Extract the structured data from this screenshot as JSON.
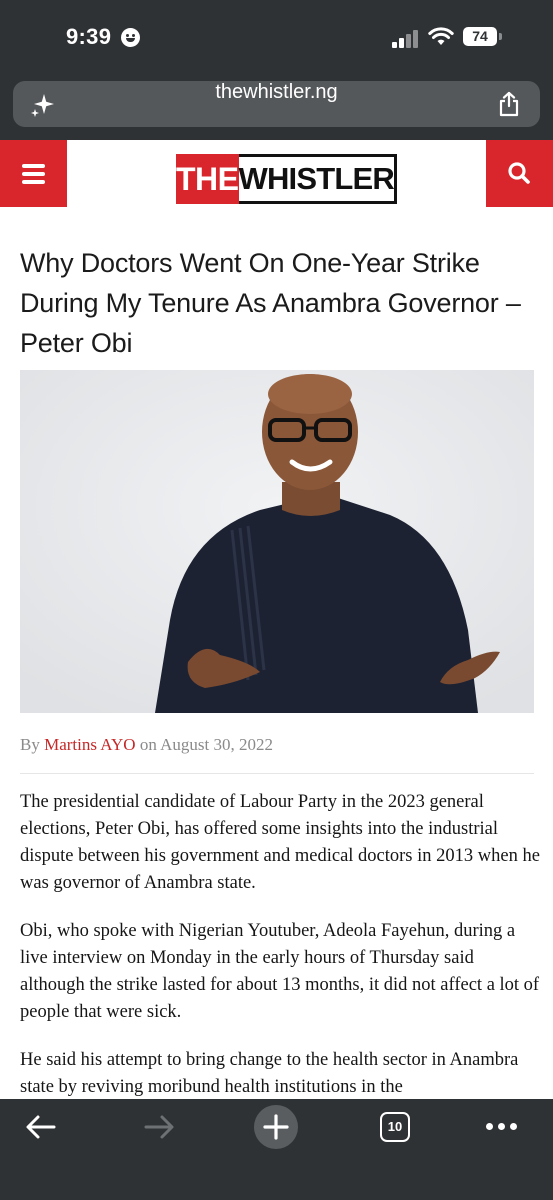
{
  "status_bar": {
    "time": "9:39",
    "battery": "74"
  },
  "browser": {
    "url": "thewhistler.ng"
  },
  "site": {
    "logo_the": "THE",
    "logo_whistler": "WHISTLER"
  },
  "article": {
    "headline": "Why Doctors Went On One-Year Strike During My Tenure As Anambra Governor – Peter Obi",
    "byline_prefix": "By",
    "author": "Martins AYO",
    "byline_mid": "on",
    "date": "August 30, 2022",
    "paragraphs": [
      "The presidential candidate of Labour Party in the 2023 general elections, Peter Obi, has offered some insights into the industrial dispute between his government and medical doctors in 2013 when he was governor of Anambra state.",
      "Obi, who spoke with Nigerian Youtuber, Adeola Fayehun, during a live interview on Monday in the early hours of Thursday said although the strike lasted for about 13 months, it did not affect a lot of people that were sick.",
      "He said his attempt to bring change to the health sector in Anambra state by reviving moribund health institutions in the"
    ]
  },
  "toolbar": {
    "tab_count": "10"
  },
  "colors": {
    "brand_red": "#d8262c",
    "chrome_dark": "#2f3234",
    "author_red": "#c62828"
  }
}
